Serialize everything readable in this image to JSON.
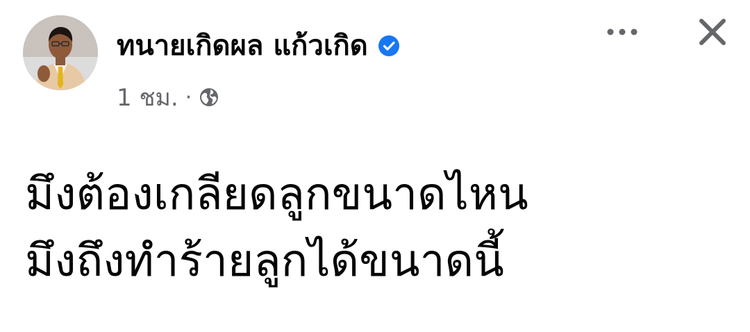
{
  "post": {
    "author": {
      "name": "ทนายเกิดผล แก้วเกิด",
      "verified": true,
      "avatar_icon": "profile-photo"
    },
    "meta": {
      "time": "1 ชม.",
      "separator": "·",
      "privacy_icon": "globe-icon"
    },
    "actions": {
      "more_icon": "more-dots-icon",
      "close_icon": "close-icon"
    },
    "text_lines": [
      "มึงต้องเกลียดลูกขนาดไหน",
      "มึงถึงทำร้ายลูกได้ขนาดนี้"
    ]
  },
  "colors": {
    "verified_badge": "#1877f2",
    "secondary_text": "#65676b",
    "primary_text": "#050505",
    "icon_gray": "#65676b"
  }
}
